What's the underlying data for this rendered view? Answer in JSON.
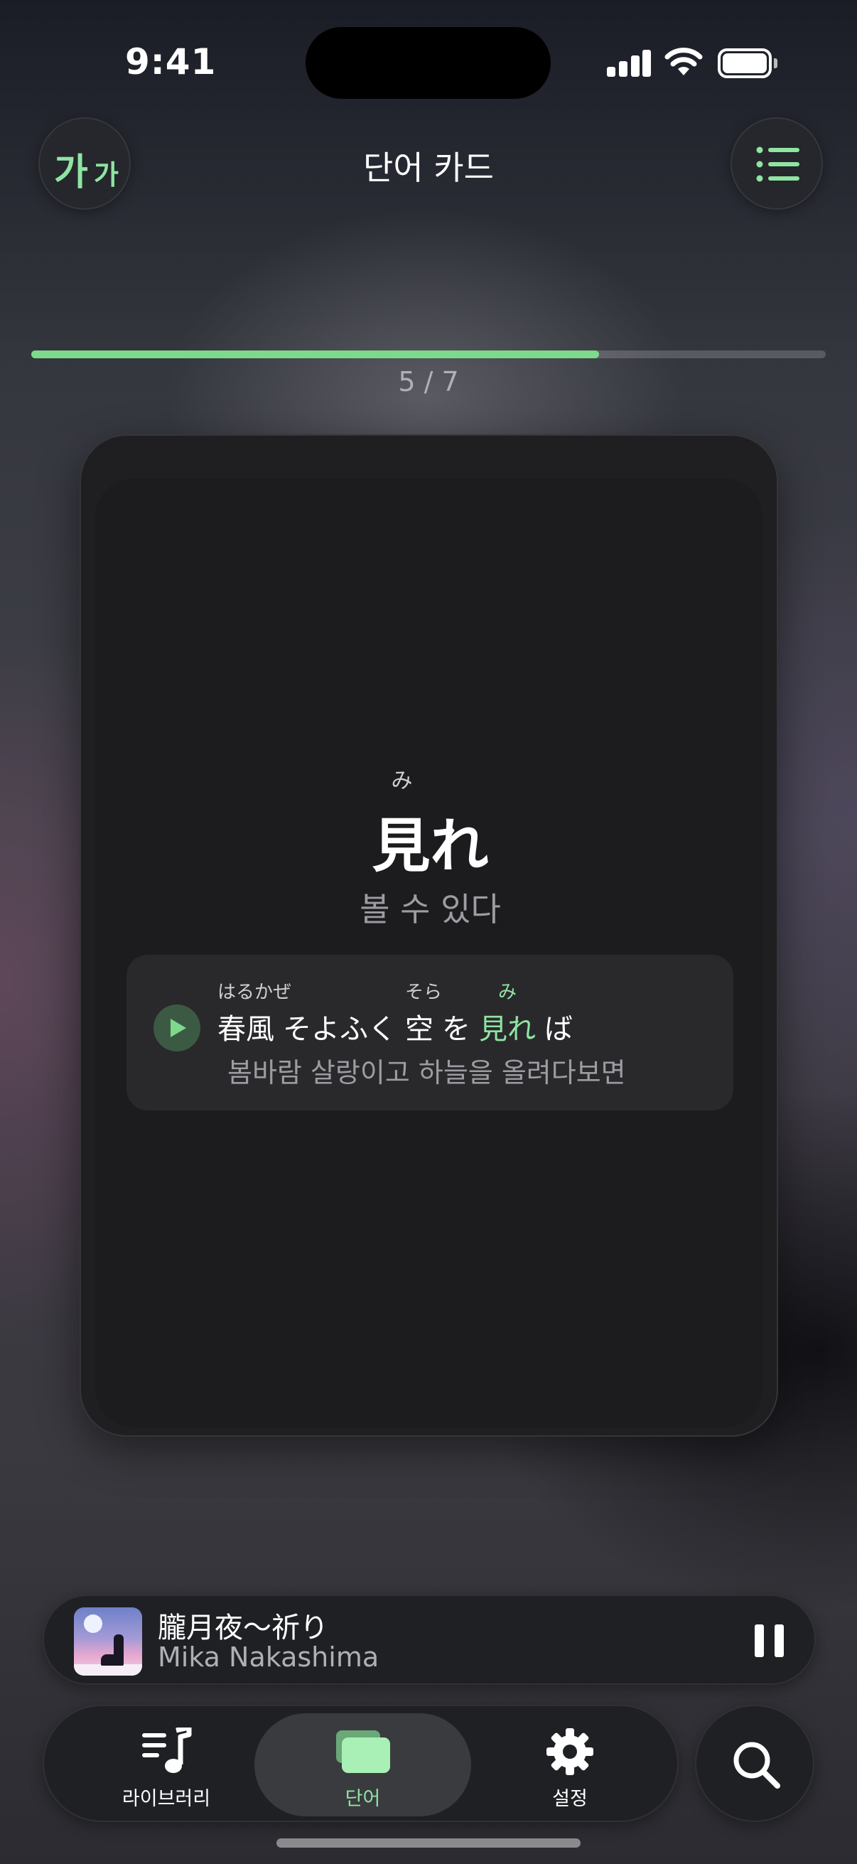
{
  "status_bar": {
    "time": "9:41",
    "signal": "signal-bars-icon",
    "wifi": "wifi-icon",
    "battery": "battery-full-icon"
  },
  "header": {
    "title": "단어 카드",
    "font_button": {
      "large": "가",
      "small": "가",
      "icon": "font-size-icon"
    },
    "list_button": {
      "icon": "list-icon"
    }
  },
  "progress": {
    "current": 5,
    "total": 7,
    "label": "5 / 7",
    "fraction": 0.714
  },
  "card": {
    "word": {
      "text": "見れ",
      "ruby": "み",
      "meaning": "볼 수 있다"
    },
    "example": {
      "segments": [
        {
          "base": "春風",
          "ruby": "はるかぜ",
          "highlight": false
        },
        {
          "base": "そよふく",
          "ruby": "",
          "highlight": false
        },
        {
          "base": "空",
          "ruby": "そら",
          "highlight": false
        },
        {
          "base": "を",
          "ruby": "",
          "highlight": false
        },
        {
          "base": "見れ",
          "ruby": "み",
          "highlight": true
        },
        {
          "base": "ば",
          "ruby": "",
          "highlight": false
        }
      ],
      "translation": "봄바람 살랑이고 하늘을 올려다보면",
      "play_icon": "play-icon"
    }
  },
  "now_playing": {
    "title": "朧月夜～祈り",
    "artist": "Mika Nakashima",
    "state_icon": "pause-icon"
  },
  "tabs": [
    {
      "label": "라이브러리",
      "icon": "music-library-icon",
      "active": false
    },
    {
      "label": "단어",
      "icon": "cards-icon",
      "active": true
    },
    {
      "label": "설정",
      "icon": "gear-icon",
      "active": false
    }
  ],
  "search": {
    "icon": "search-icon"
  },
  "colors": {
    "accent": "#8fe4a2",
    "progress": "#7dd98b",
    "card": "#1c1c1e",
    "background": "#3a393f"
  }
}
